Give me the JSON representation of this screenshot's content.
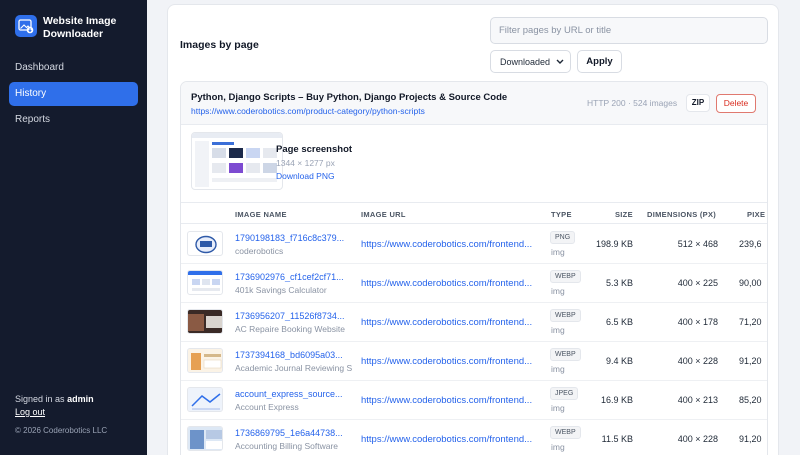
{
  "app": {
    "title": "Website Image Downloader",
    "accent": "#2f6fea",
    "sidebar_bg": "#141b2d"
  },
  "sidebar": {
    "items": [
      {
        "label": "Dashboard",
        "active": false
      },
      {
        "label": "History",
        "active": true
      },
      {
        "label": "Reports",
        "active": false
      }
    ],
    "signed_in_prefix": "Signed in as",
    "username": "admin",
    "logout": "Log out",
    "copyright": "© 2026 Coderobotics LLC"
  },
  "main": {
    "title": "Images by page",
    "filter_placeholder": "Filter pages by URL or title",
    "status_select": "Downloaded",
    "apply_label": "Apply"
  },
  "page": {
    "title": "Python, Django Scripts – Buy Python, Django Projects & Source Code",
    "url": "https://www.coderobotics.com/product-category/python-scripts",
    "meta": "HTTP 200 · 524 images",
    "zip_label": "ZIP",
    "delete_label": "Delete",
    "screenshot": {
      "title": "Page screenshot",
      "size": "1344 × 1277 px",
      "download": "Download PNG"
    }
  },
  "table": {
    "headers": [
      "IMAGE NAME",
      "IMAGE URL",
      "TYPE",
      "SIZE",
      "DIMENSIONS (PX)",
      "PIXE"
    ],
    "rows": [
      {
        "name": "1790198183_f716c8c379...",
        "sub": "coderobotics",
        "url": "https://www.coderobotics.com/frontend...",
        "type": "PNG",
        "kind": "img",
        "size": "198.9 KB",
        "dims": "512 × 468",
        "pixels": "239,6"
      },
      {
        "name": "1736902976_cf1cef2cf71...",
        "sub": "401k Savings Calculator",
        "url": "https://www.coderobotics.com/frontend...",
        "type": "WEBP",
        "kind": "img",
        "size": "5.3 KB",
        "dims": "400 × 225",
        "pixels": "90,00"
      },
      {
        "name": "1736956207_11526f8734...",
        "sub": "AC Repaire Booking Website",
        "url": "https://www.coderobotics.com/frontend...",
        "type": "WEBP",
        "kind": "img",
        "size": "6.5 KB",
        "dims": "400 × 178",
        "pixels": "71,20"
      },
      {
        "name": "1737394168_bd6095a03...",
        "sub": "Academic Journal Reviewing S",
        "url": "https://www.coderobotics.com/frontend...",
        "type": "WEBP",
        "kind": "img",
        "size": "9.4 KB",
        "dims": "400 × 228",
        "pixels": "91,20"
      },
      {
        "name": "account_express_source...",
        "sub": "Account Express",
        "url": "https://www.coderobotics.com/frontend...",
        "type": "JPEG",
        "kind": "img",
        "size": "16.9 KB",
        "dims": "400 × 213",
        "pixels": "85,20"
      },
      {
        "name": "1736869795_1e6a44738...",
        "sub": "Accounting Billing Software",
        "url": "https://www.coderobotics.com/frontend...",
        "type": "WEBP",
        "kind": "img",
        "size": "11.5 KB",
        "dims": "400 × 228",
        "pixels": "91,20"
      }
    ]
  }
}
